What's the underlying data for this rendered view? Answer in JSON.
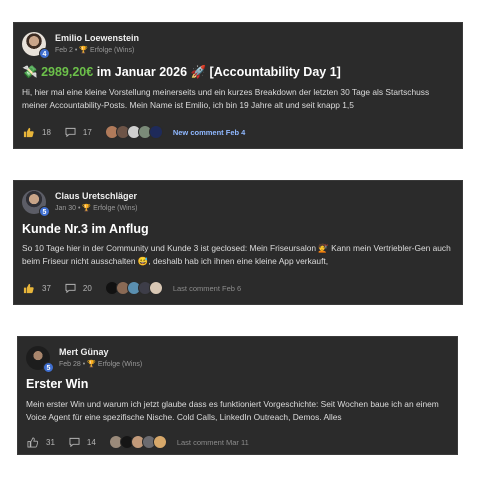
{
  "posts": [
    {
      "author": "Emilio Loewenstein",
      "level": "4",
      "date": "Feb 2",
      "separator": "•",
      "category_icon": "🏆",
      "category": "Erfolge (Wins)",
      "title_prefix": "💸",
      "title_amount": "2989,20€",
      "title_rest": "im Januar 2026 🚀 [Accountability Day 1]",
      "body": "Hi, hier mal eine kleine Vorstellung meinerseits und ein kurzes Breakdown der letzten 30 Tage als Startschuss meiner Accountability-Posts. Mein Name ist Emilio, ich bin 19 Jahre alt und seit knapp 1,5",
      "likes": "18",
      "comments": "17",
      "last_comment": "New comment Feb 4",
      "last_comment_is_new": true,
      "commenter_colors": [
        "#b07a5a",
        "#6d5447",
        "#cfcfcf",
        "#7a8a78",
        "#1e2a5a"
      ]
    },
    {
      "author": "Claus Uretschläger",
      "level": "5",
      "date": "Jan 30",
      "separator": "•",
      "category_icon": "🏆",
      "category": "Erfolge (Wins)",
      "title": "Kunde Nr.3 im Anflug",
      "body": "So 10 Tage hier in der Community und Kunde 3 ist geclosed: Mein Friseursalon 💇 Kann mein Vertriebler-Gen auch beim Friseur nicht ausschalten 😅, deshalb hab ich ihnen eine kleine App verkauft,",
      "likes": "37",
      "comments": "20",
      "last_comment": "Last comment Feb 6",
      "last_comment_is_new": false,
      "commenter_colors": [
        "#111111",
        "#8a6a55",
        "#5a8fb0",
        "#3d3d48",
        "#d8c7b4"
      ]
    },
    {
      "author": "Mert Günay",
      "level": "5",
      "date": "Feb 28",
      "separator": "•",
      "category_icon": "🏆",
      "category": "Erfolge (Wins)",
      "title": "Erster Win",
      "body": "Mein erster Win und warum ich jetzt glaube dass es funktioniert Vorgeschichte: Seit Wochen baue ich an einem Voice Agent für eine spezifische Nische. Cold Calls, LinkedIn Outreach, Demos. Alles",
      "likes": "31",
      "comments": "14",
      "last_comment": "Last comment Mar 11",
      "last_comment_is_new": false,
      "commenter_colors": [
        "#9a8a7a",
        "#151515",
        "#c29a7a",
        "#6b6b70",
        "#d7a86a"
      ]
    }
  ]
}
